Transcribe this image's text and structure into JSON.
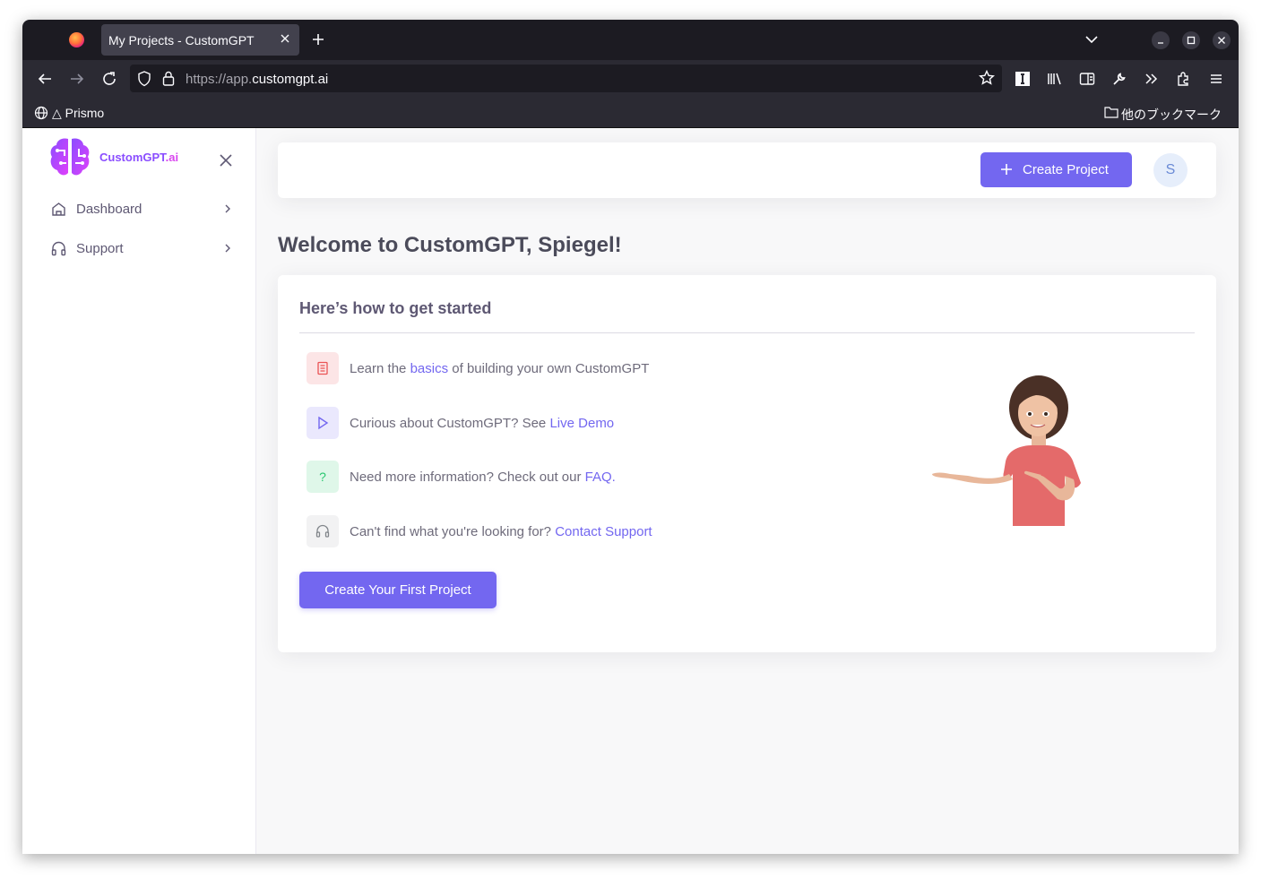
{
  "browser": {
    "tab_title": "My Projects - CustomGPT",
    "url_prefix": "https://app.",
    "url_domain": "customgpt.ai",
    "bookmarks": {
      "prismo": "△ Prismo",
      "other": "他のブックマーク"
    }
  },
  "sidebar": {
    "logo_text": "CustomGPT",
    "logo_suffix": ".ai",
    "items": [
      {
        "label": "Dashboard",
        "icon": "home-icon"
      },
      {
        "label": "Support",
        "icon": "headphones-icon"
      }
    ]
  },
  "header": {
    "create_label": "Create Project",
    "avatar_initial": "S"
  },
  "main": {
    "welcome": "Welcome to CustomGPT, Spiegel!",
    "card_title": "Here’s how to get started",
    "steps": [
      {
        "before": "Learn the ",
        "link": "basics",
        "after": " of building your own CustomGPT",
        "icon": "document-icon",
        "color": "#ea5455",
        "bg": "#fce5e6"
      },
      {
        "before": "Curious about CustomGPT? See ",
        "link": "Live Demo",
        "after": "",
        "icon": "play-icon",
        "color": "#7367f0",
        "bg": "#eae8fd"
      },
      {
        "before": "Need more information? Check out our ",
        "link": "FAQ",
        "after": ".",
        "icon": "question-icon",
        "color": "#28c76f",
        "bg": "#dff7e9"
      },
      {
        "before": "Can't find what you're looking for? ",
        "link": "Contact Support",
        "after": "",
        "icon": "headset-icon",
        "color": "#82868b",
        "bg": "#f2f2f3"
      }
    ],
    "first_project_label": "Create Your First Project"
  },
  "colors": {
    "accent": "#7367f0",
    "text": "#5e5873",
    "chrome": "#1c1b22"
  }
}
